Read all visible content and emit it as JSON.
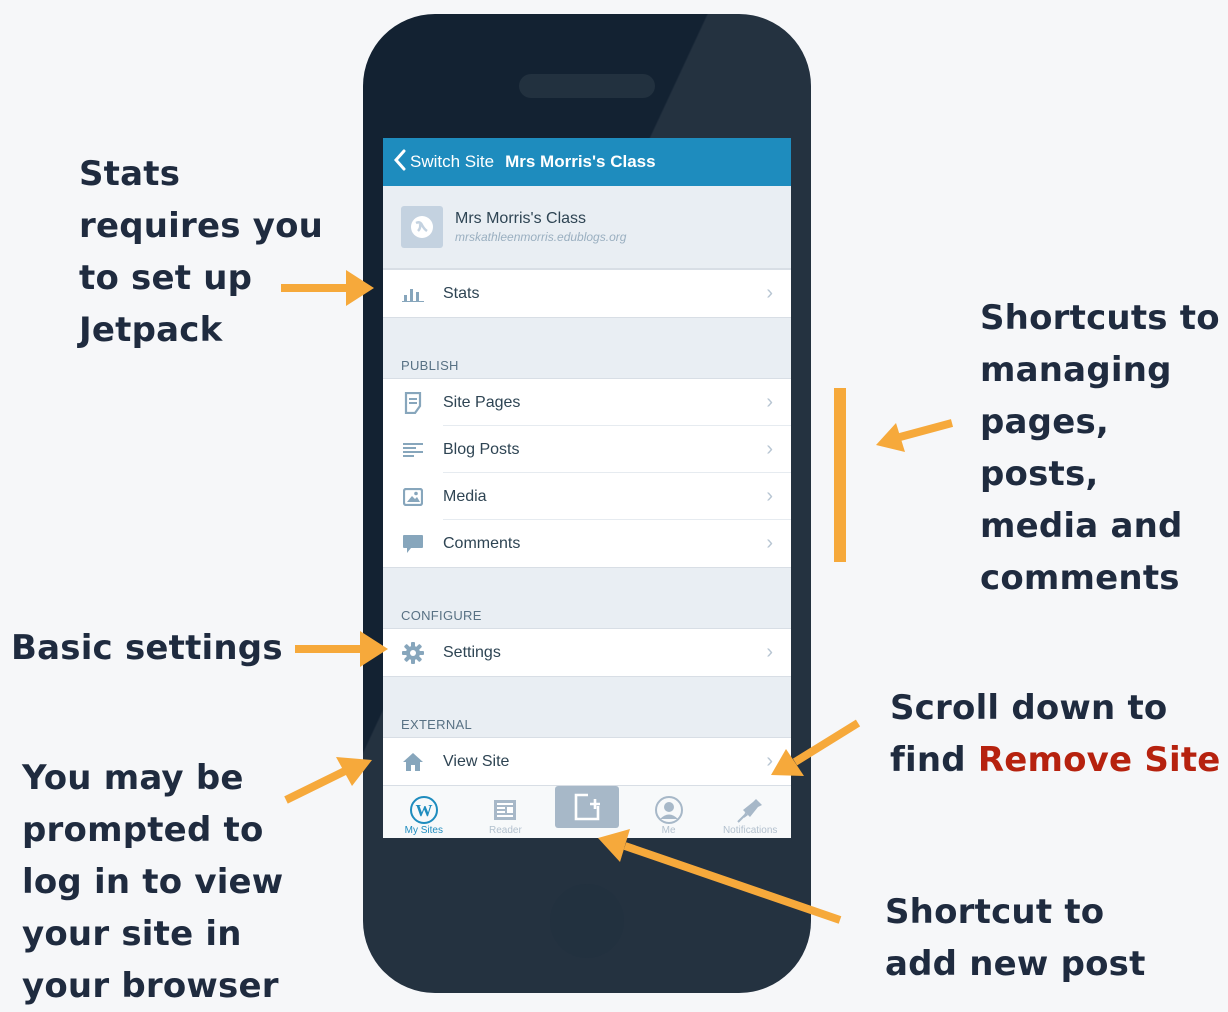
{
  "annotations": {
    "stats": [
      "Stats",
      "requires you",
      "to set up",
      "Jetpack"
    ],
    "shortcuts": [
      "Shortcuts to",
      "managing",
      "pages, posts,",
      "media and",
      "comments"
    ],
    "basic_settings": "Basic settings",
    "login": [
      "You may be",
      "prompted to",
      "log in to view",
      "your site in",
      "your browser"
    ],
    "scroll_line1": "Scroll down to",
    "scroll_line2_prefix": "find ",
    "scroll_line2_highlight": "Remove Site",
    "add_post": [
      "Shortcut to",
      "add new post"
    ]
  },
  "app": {
    "navbar": {
      "back_label": "Switch Site",
      "title": "Mrs Morris's Class"
    },
    "site": {
      "name": "Mrs Morris's Class",
      "url": "mrskathleenmorris.edublogs.org"
    },
    "stats_label": "Stats",
    "sections": {
      "publish": "PUBLISH",
      "configure": "CONFIGURE",
      "external": "EXTERNAL"
    },
    "publish_items": [
      "Site Pages",
      "Blog Posts",
      "Media",
      "Comments"
    ],
    "settings_label": "Settings",
    "view_site_label": "View Site",
    "tabs": [
      "My Sites",
      "Reader",
      "Me",
      "Notifications"
    ]
  },
  "colors": {
    "accent_blue": "#1e8cbe",
    "annotation_text": "#1f2b3f",
    "arrow": "#f6a93b",
    "highlight_red": "#b6220f",
    "phone_body": "#132232"
  },
  "icons": [
    "stats-icon",
    "page-icon",
    "posts-icon",
    "media-icon",
    "comment-icon",
    "gear-icon",
    "home-icon",
    "wordpress-icon",
    "reader-icon",
    "add-post-icon",
    "me-icon",
    "bell-icon",
    "globe-icon",
    "chevron-left-icon",
    "chevron-right-icon"
  ]
}
